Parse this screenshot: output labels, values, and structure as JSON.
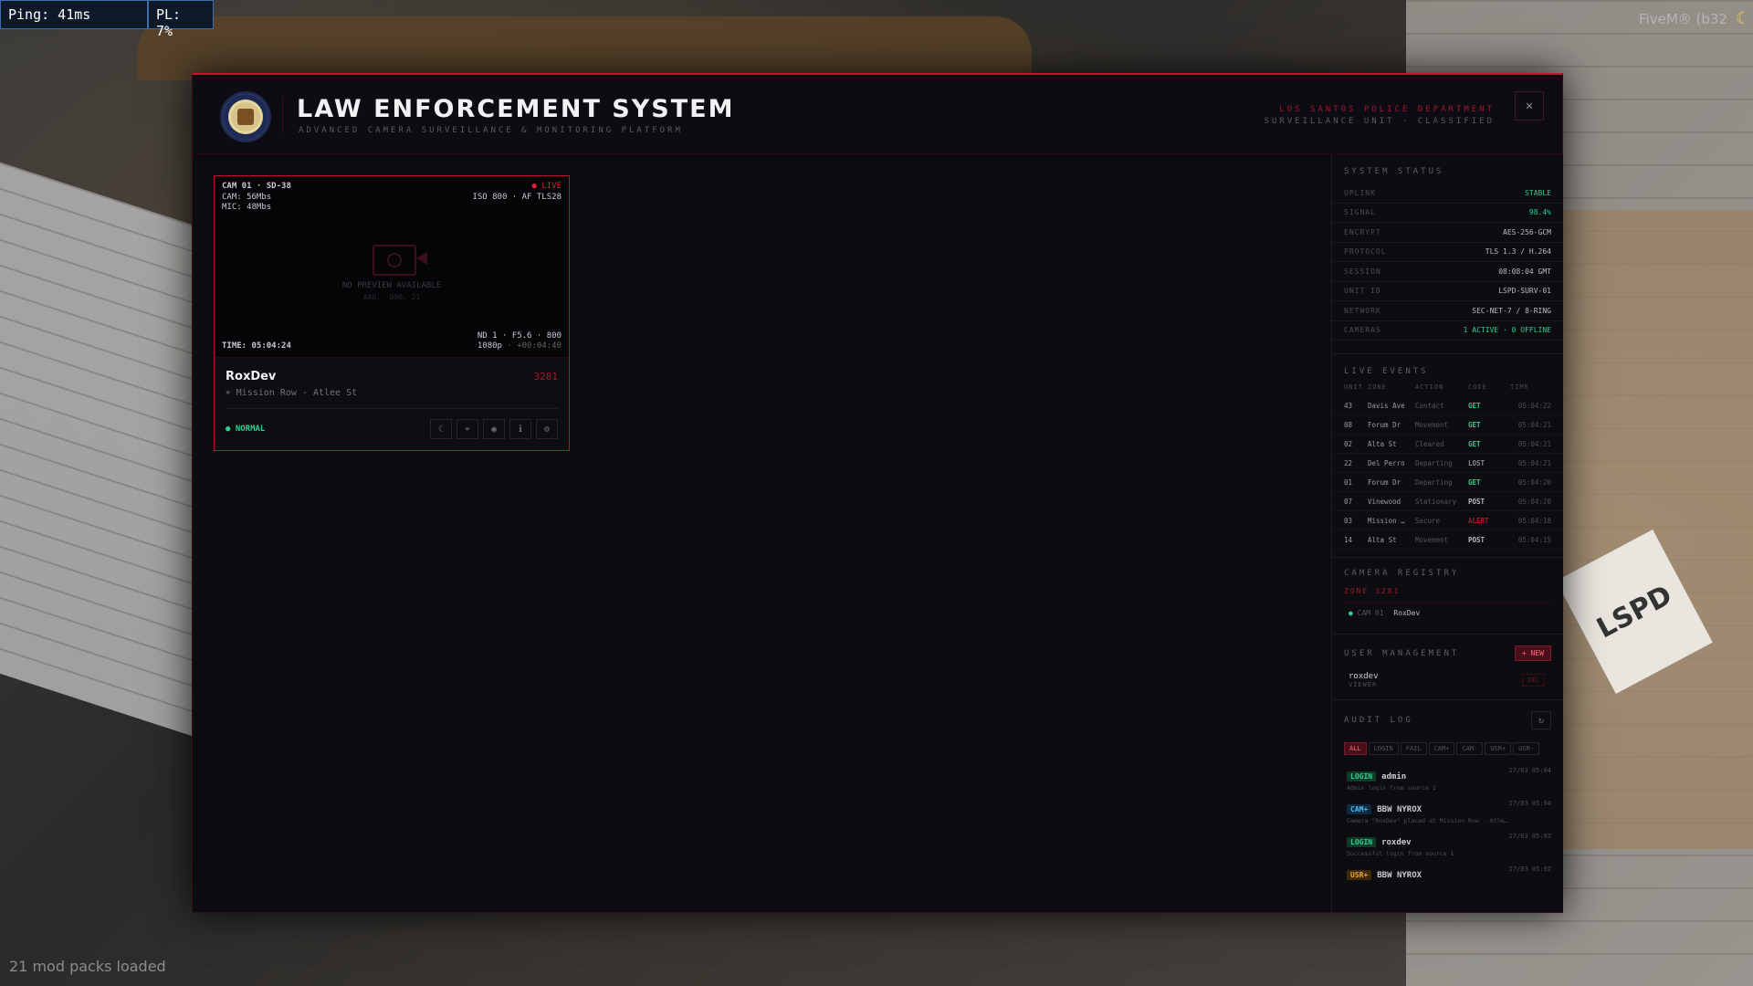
{
  "hud": {
    "ping": "Ping: 41ms",
    "pl": "PL: 7%",
    "fivem": "FiveM® (b32",
    "mods": "21 mod packs loaded",
    "lspd_paper": "LSPD"
  },
  "header": {
    "title": "LAW ENFORCEMENT SYSTEM",
    "subtitle": "ADVANCED CAMERA SURVEILLANCE & MONITORING PLATFORM",
    "dept": "LOS SANTOS POLICE DEPARTMENT",
    "dept_sub": "SURVEILLANCE UNIT · CLASSIFIED",
    "close": "✕"
  },
  "camera": {
    "id": "CAM 01 · SD-38",
    "live": "● LIVE",
    "cam_rate": "CAM: 56Mbs",
    "mic_rate": "MIC: 48Mbs",
    "iso": "ISO 800 · AF TLS28",
    "no_preview": "NO PREVIEW AVAILABLE",
    "no_preview_sub": "AAG, -000, 21",
    "time": "TIME: 05:04:24",
    "nd": "ND 1 · F5.6 · 800",
    "res": "1080p",
    "offset": "+00:04:40",
    "name": "RoxDev",
    "code": "3281",
    "location": "Mission Row - Atlee St",
    "status": "● NORMAL"
  },
  "system_status": {
    "title": "SYSTEM STATUS",
    "rows": [
      {
        "k": "UPLINK",
        "v": "STABLE"
      },
      {
        "k": "SIGNAL",
        "v": "98.4%"
      },
      {
        "k": "ENCRYPT",
        "v": "AES-256-GCM"
      },
      {
        "k": "PROTOCOL",
        "v": "TLS 1.3 / H.264"
      },
      {
        "k": "SESSION",
        "v": "08:08:04 GMT"
      },
      {
        "k": "UNIT ID",
        "v": "LSPD-SURV-01"
      },
      {
        "k": "NETWORK",
        "v": "SEC-NET-7 / 8-RING"
      },
      {
        "k": "CAMERAS",
        "v": "1 ACTIVE · 0 OFFLINE"
      }
    ]
  },
  "live_events": {
    "title": "LIVE EVENTS",
    "headers": [
      "UNIT",
      "ZONE",
      "ACTION",
      "CODE",
      "TIME"
    ],
    "rows": [
      {
        "unit": "43",
        "zone": "Davis Ave",
        "action": "Contact",
        "code": "GET",
        "time": "05:04:22"
      },
      {
        "unit": "08",
        "zone": "Forum Dr",
        "action": "Movement",
        "code": "GET",
        "time": "05:04:21"
      },
      {
        "unit": "02",
        "zone": "Alta St",
        "action": "Cleared",
        "code": "GET",
        "time": "05:04:21"
      },
      {
        "unit": "22",
        "zone": "Del Perro",
        "action": "Departing",
        "code": "LOST",
        "time": "05:04:21"
      },
      {
        "unit": "01",
        "zone": "Forum Dr",
        "action": "Departing",
        "code": "GET",
        "time": "05:04:20"
      },
      {
        "unit": "07",
        "zone": "Vinewood",
        "action": "Stationary",
        "code": "POST",
        "time": "05:04:20"
      },
      {
        "unit": "03",
        "zone": "Mission …",
        "action": "Secure",
        "code": "ALERT",
        "time": "05:04:18"
      },
      {
        "unit": "14",
        "zone": "Alta St",
        "action": "Movement",
        "code": "POST",
        "time": "05:04:15"
      }
    ]
  },
  "registry": {
    "title": "CAMERA REGISTRY",
    "zone": "ZONE 3281",
    "cam_id": "CAM 01",
    "cam_name": "RoxDev"
  },
  "users": {
    "title": "USER MANAGEMENT",
    "new_btn": "+ NEW",
    "user": "roxdev",
    "role": "VIEWER",
    "del_btn": "DEL"
  },
  "audit": {
    "title": "AUDIT LOG",
    "refresh": "↻",
    "filters": [
      "ALL",
      "LOGIN",
      "FAIL",
      "CAM+",
      "CAM-",
      "USR+",
      "USR-"
    ],
    "entries": [
      {
        "badge": "LOGIN",
        "user": "admin",
        "time": "17/03 05:04",
        "desc": "Admin login from source 1"
      },
      {
        "badge": "CAM+",
        "user": "BBW NYROX",
        "time": "17/03 05:04",
        "desc": "Camera \"RoxDev\" placed at Mission Row - Atle…"
      },
      {
        "badge": "LOGIN",
        "user": "roxdev",
        "time": "17/03 05:02",
        "desc": "Successful login from source 1"
      },
      {
        "badge": "USR+",
        "user": "BBW NYROX",
        "time": "17/03 05:02",
        "desc": ""
      }
    ]
  },
  "colors": {
    "accent": "#c8142d",
    "ok": "#2ecf8c",
    "cam": "#4fb5ee",
    "usr": "#f0a23a"
  }
}
